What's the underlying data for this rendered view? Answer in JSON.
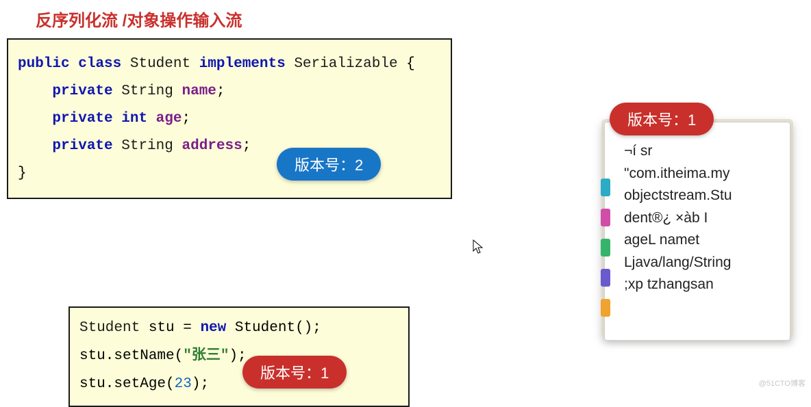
{
  "title": "反序列化流 /对象操作输入流",
  "codeTop": {
    "l1": {
      "kw1": "public",
      "kw2": "class",
      "cls": "Student",
      "kw3": "implements",
      "iface": "Serializable",
      "brace": " {"
    },
    "l2": {
      "kw": "private",
      "type": "String",
      "name": "name",
      "semi": ";"
    },
    "l3": {
      "kw": "private",
      "type": "int",
      "name": "age",
      "semi": ";"
    },
    "l4": {
      "kw": "private",
      "type": "String",
      "name": "address",
      "semi": ";"
    },
    "l5": "}"
  },
  "codeBottom": {
    "l1": {
      "cls": "Student",
      "var": " stu = ",
      "kw": "new",
      "call": " Student();"
    },
    "l2": {
      "pre": "stu.setName(",
      "q1": "\"",
      "str": "张三",
      "q2": "\"",
      "post": ");"
    },
    "l3": {
      "pre": "stu.setAge(",
      "num": "23",
      "post": ");"
    }
  },
  "pills": {
    "blue": "版本号：2",
    "red1": "版本号：1",
    "red2": "版本号：1"
  },
  "notepad": "¬í sr\n\"com.itheima.my\nobjectstream.Stu\ndent®¿ ×àb I\nageL namet\nLjava/lang/String\n;xp   tzhangsan",
  "watermark": "@51CTO博客"
}
